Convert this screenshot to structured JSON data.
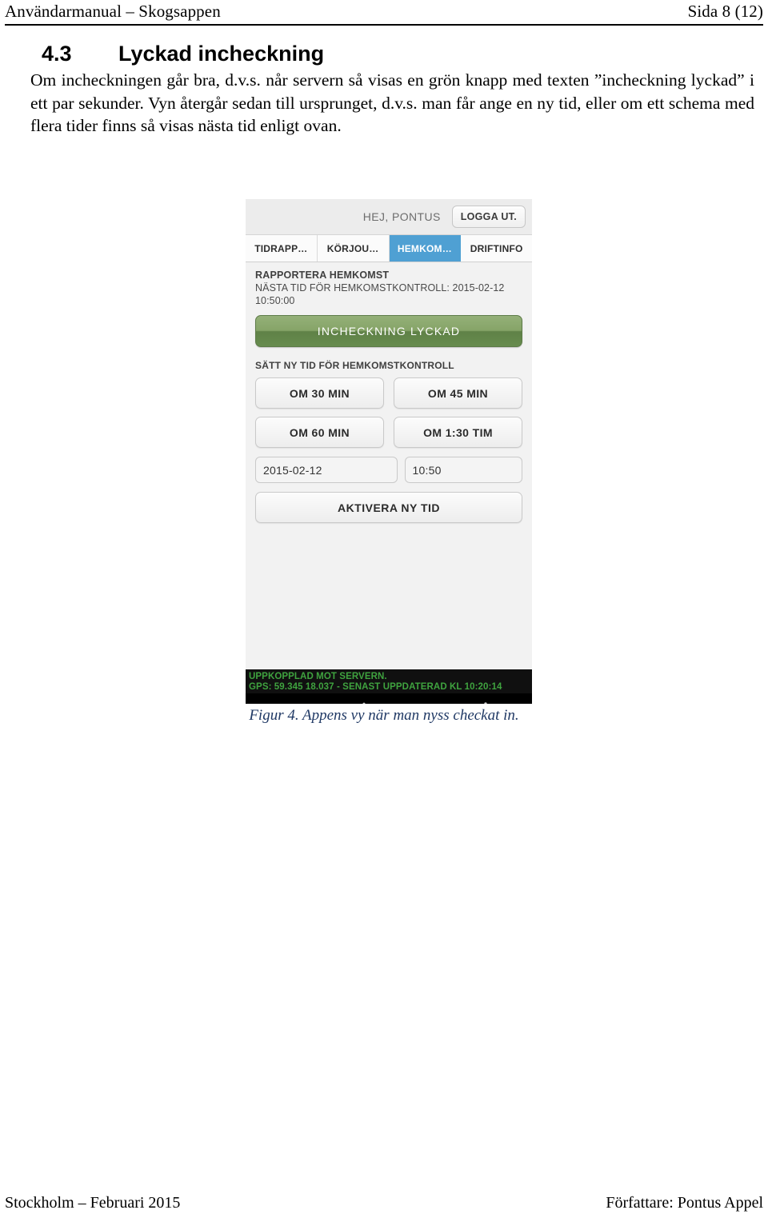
{
  "document": {
    "header_left": "Användarmanual – Skogsappen",
    "header_right": "Sida 8 (12)",
    "footer_left": "Stockholm – Februari 2015",
    "footer_right": "Författare: Pontus Appel"
  },
  "section": {
    "number": "4.3",
    "title": "Lyckad incheckning",
    "paragraph": "Om incheckningen går bra, d.v.s. når servern så visas en grön knapp med texten ”incheckning lyckad” i ett par sekunder. Vyn återgår sedan till ursprunget, d.v.s. man får ange en ny tid, eller om ett schema med flera tider finns så visas nästa tid enligt ovan."
  },
  "figure": {
    "caption": "Figur 4. Appens vy när man nyss checkat in."
  },
  "app": {
    "greeting": "HEJ, PONTUS",
    "logout_label": "LOGGA UT.",
    "tabs": [
      {
        "label": "TIDRAPP…",
        "active": false
      },
      {
        "label": "KÖRJOU…",
        "active": false
      },
      {
        "label": "HEMKOM…",
        "active": true
      },
      {
        "label": "DRIFTINFO",
        "active": false
      }
    ],
    "report_heading": "RAPPORTERA HEMKOMST",
    "next_time_line": "NÄSTA TID FÖR HEMKOMSTKONTROLL: 2015-02-12",
    "next_time_line2": "10:50:00",
    "success_button": "INCHECKNING LYCKAD",
    "set_new_time_label": "SÄTT NY TID FÖR HEMKOMSTKONTROLL",
    "quick_buttons": [
      "OM 30 MIN",
      "OM 45 MIN",
      "OM 60 MIN",
      "OM 1:30 TIM"
    ],
    "date_value": "2015-02-12",
    "time_value": "10:50",
    "activate_button": "AKTIVERA NY TID",
    "status_line_1": "UPPKOPPLAD MOT SERVERN.",
    "status_line_2": "GPS: 59.345 18.037 - SENAST UPPDATERAD KL 10:20:14",
    "colors": {
      "tab_active": "#4fa0d3",
      "success_green": "#6f9050",
      "status_green": "#3fa33f",
      "caption_blue": "#1f3864"
    }
  }
}
